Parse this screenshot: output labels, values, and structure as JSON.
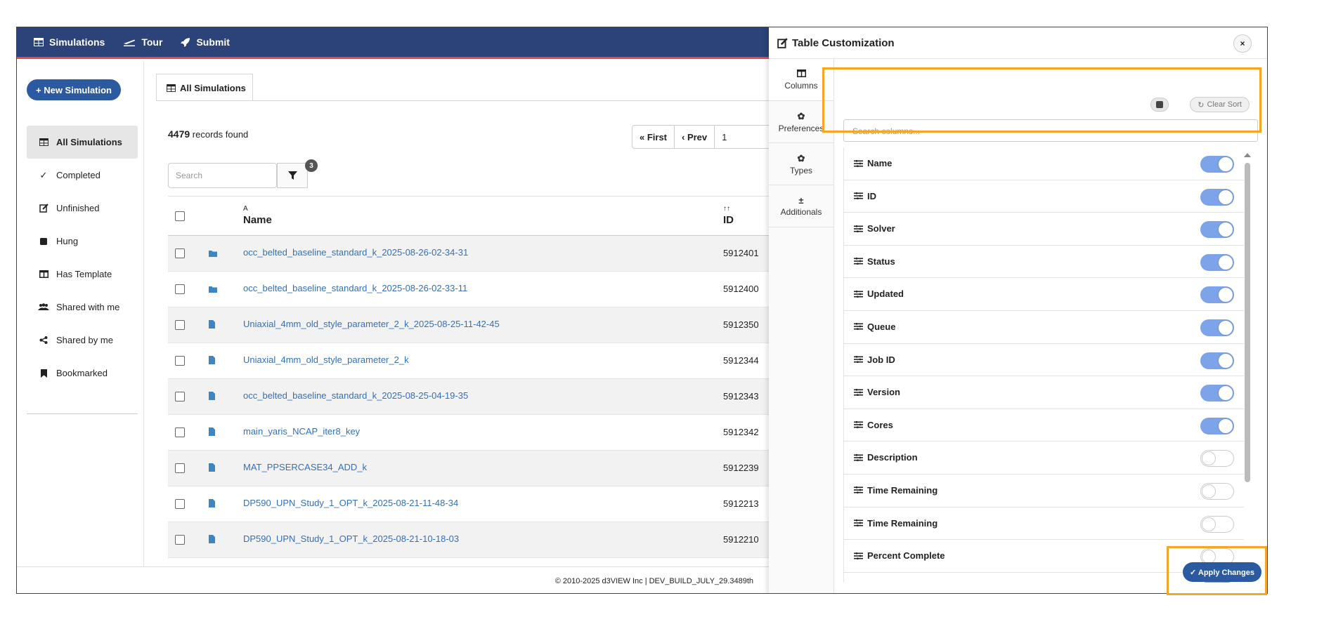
{
  "topbar": {
    "items": [
      {
        "label": "Simulations",
        "icon": "table-icon"
      },
      {
        "label": "Tour",
        "icon": "plane-icon"
      },
      {
        "label": "Submit",
        "icon": "rocket-icon"
      }
    ]
  },
  "sidebar": {
    "new_button": "+ New Simulation",
    "items": [
      {
        "label": "All Simulations",
        "icon": "table-icon",
        "active": true
      },
      {
        "label": "Completed",
        "icon": "check-icon"
      },
      {
        "label": "Unfinished",
        "icon": "edit-icon"
      },
      {
        "label": "Hung",
        "icon": "square-icon"
      },
      {
        "label": "Has Template",
        "icon": "columns-icon"
      },
      {
        "label": "Shared with me",
        "icon": "users-icon"
      },
      {
        "label": "Shared by me",
        "icon": "share-icon"
      },
      {
        "label": "Bookmarked",
        "icon": "bookmark-icon"
      }
    ]
  },
  "main": {
    "tab_label": "All Simulations",
    "records_count": "4479",
    "records_suffix": "records found",
    "pager": {
      "first": "« First",
      "prev": "‹ Prev",
      "page": "1"
    },
    "search_placeholder": "Search",
    "filter_count": "3",
    "columns": {
      "name_sort": "A",
      "name": "Name",
      "id_sort": "↑↑",
      "id": "ID"
    },
    "rows": [
      {
        "type": "folder",
        "name": "occ_belted_baseline_standard_k_2025-08-26-02-34-31",
        "id": "5912401"
      },
      {
        "type": "folder",
        "name": "occ_belted_baseline_standard_k_2025-08-26-02-33-11",
        "id": "5912400"
      },
      {
        "type": "file",
        "name": "Uniaxial_4mm_old_style_parameter_2_k_2025-08-25-11-42-45",
        "id": "5912350"
      },
      {
        "type": "file",
        "name": "Uniaxial_4mm_old_style_parameter_2_k",
        "id": "5912344"
      },
      {
        "type": "file",
        "name": "occ_belted_baseline_standard_k_2025-08-25-04-19-35",
        "id": "5912343"
      },
      {
        "type": "file",
        "name": "main_yaris_NCAP_iter8_key",
        "id": "5912342"
      },
      {
        "type": "file",
        "name": "MAT_PPSERCASE34_ADD_k",
        "id": "5912239"
      },
      {
        "type": "file",
        "name": "DP590_UPN_Study_1_OPT_k_2025-08-21-11-48-34",
        "id": "5912213"
      },
      {
        "type": "file",
        "name": "DP590_UPN_Study_1_OPT_k_2025-08-21-10-18-03",
        "id": "5912210"
      }
    ]
  },
  "footer": "© 2010-2025 d3VIEW Inc | DEV_BUILD_JULY_29.3489th",
  "panel": {
    "title": "Table Customization",
    "close": "×",
    "tabs": [
      {
        "label": "Columns",
        "icon": "columns-icon",
        "active": true
      },
      {
        "label": "Preferences",
        "icon": "gear-icon"
      },
      {
        "label": "Types",
        "icon": "gear-icon"
      },
      {
        "label": "Additionals",
        "icon": "plus-minus-icon"
      }
    ],
    "clear_sort": "Clear Sort",
    "search_placeholder": "Search columns...",
    "columns": [
      {
        "label": "Name",
        "on": true
      },
      {
        "label": "ID",
        "on": true
      },
      {
        "label": "Solver",
        "on": true
      },
      {
        "label": "Status",
        "on": true
      },
      {
        "label": "Updated",
        "on": true
      },
      {
        "label": "Queue",
        "on": true
      },
      {
        "label": "Job ID",
        "on": true
      },
      {
        "label": "Version",
        "on": true
      },
      {
        "label": "Cores",
        "on": true
      },
      {
        "label": "Description",
        "on": false
      },
      {
        "label": "Time Remaining",
        "on": false
      },
      {
        "label": "Time Remaining",
        "on": false
      },
      {
        "label": "Percent Complete",
        "on": false
      },
      {
        "label": "",
        "on": true
      }
    ],
    "apply_button": "✓ Apply Changes"
  },
  "colors": {
    "topbar": "#2c4379",
    "accent": "#2c5aa0",
    "link": "#3470b8",
    "toggle_on": "#7da3e8",
    "highlight": "#f5a623"
  }
}
